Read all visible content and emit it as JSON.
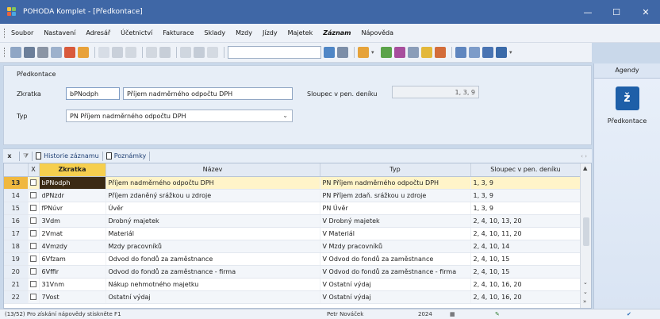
{
  "window": {
    "title": "POHODA Komplet - [Předkontace]",
    "controls": [
      "—",
      "☐",
      "✕"
    ]
  },
  "menu": [
    "Soubor",
    "Nastavení",
    "Adresář",
    "Účetnictví",
    "Fakturace",
    "Sklady",
    "Mzdy",
    "Jízdy",
    "Majetek",
    "Záznam",
    "Nápověda"
  ],
  "form": {
    "legend": "Předkontace",
    "zkratka_label": "Zkratka",
    "zkratka_value": "bPNodph",
    "nazev_value": "Příjem nadměrného odpočtu DPH",
    "sloupec_label": "Sloupec v pen. deníku",
    "sloupec_value": "1, 3, 9",
    "typ_label": "Typ",
    "typ_value": "PN Příjem nadměrného odpočtu DPH"
  },
  "agenda": {
    "header": "Agendy",
    "item": "Předkontace"
  },
  "tabs": {
    "close": "x",
    "history": "Historie záznamu",
    "notes": "Poznámky"
  },
  "grid": {
    "columns": [
      "X",
      "Zkratka",
      "Název",
      "Typ",
      "Sloupec v pen. deníku"
    ],
    "rows": [
      {
        "n": "13",
        "code": "bPNodph",
        "name": "Příjem nadměrného odpočtu DPH",
        "type": "PN Příjem nadměrného odpočtu DPH",
        "col": "1, 3, 9"
      },
      {
        "n": "14",
        "code": "dPNzdr",
        "name": "Příjem zdaněný srážkou u zdroje",
        "type": "PN Příjem zdaň. srážkou u zdroje",
        "col": "1, 3, 9"
      },
      {
        "n": "15",
        "code": "fPNúvr",
        "name": "Úvěr",
        "type": "PN Úvěr",
        "col": "1, 3, 9"
      },
      {
        "n": "16",
        "code": "3Vdm",
        "name": "Drobný majetek",
        "type": "V Drobný majetek",
        "col": "2, 4, 10, 13, 20"
      },
      {
        "n": "17",
        "code": "2Vmat",
        "name": "Materiál",
        "type": "V Materiál",
        "col": "2, 4, 10, 11, 20"
      },
      {
        "n": "18",
        "code": "4Vmzdy",
        "name": "Mzdy pracovníků",
        "type": "V Mzdy pracovníků",
        "col": "2, 4, 10, 14"
      },
      {
        "n": "19",
        "code": "6Vfzam",
        "name": "Odvod do fondů za zaměstnance",
        "type": "V Odvod do fondů za zaměstnance",
        "col": "2, 4, 10, 15"
      },
      {
        "n": "20",
        "code": "6Vffir",
        "name": "Odvod do fondů za zaměstnance - firma",
        "type": "V Odvod do fondů za zaměstnance - firma",
        "col": "2, 4, 10, 15"
      },
      {
        "n": "21",
        "code": "31Vnm",
        "name": "Nákup nehmotného majetku",
        "type": "V Ostatní výdaj",
        "col": "2, 4, 10, 16, 20"
      },
      {
        "n": "22",
        "code": "7Vost",
        "name": "Ostatní výdaj",
        "type": "V Ostatní výdaj",
        "col": "2, 4, 10, 16, 20"
      }
    ]
  },
  "status": {
    "hint": "(13/52) Pro získání nápovědy stiskněte F1",
    "user": "Petr Nováček",
    "year": "2024"
  }
}
